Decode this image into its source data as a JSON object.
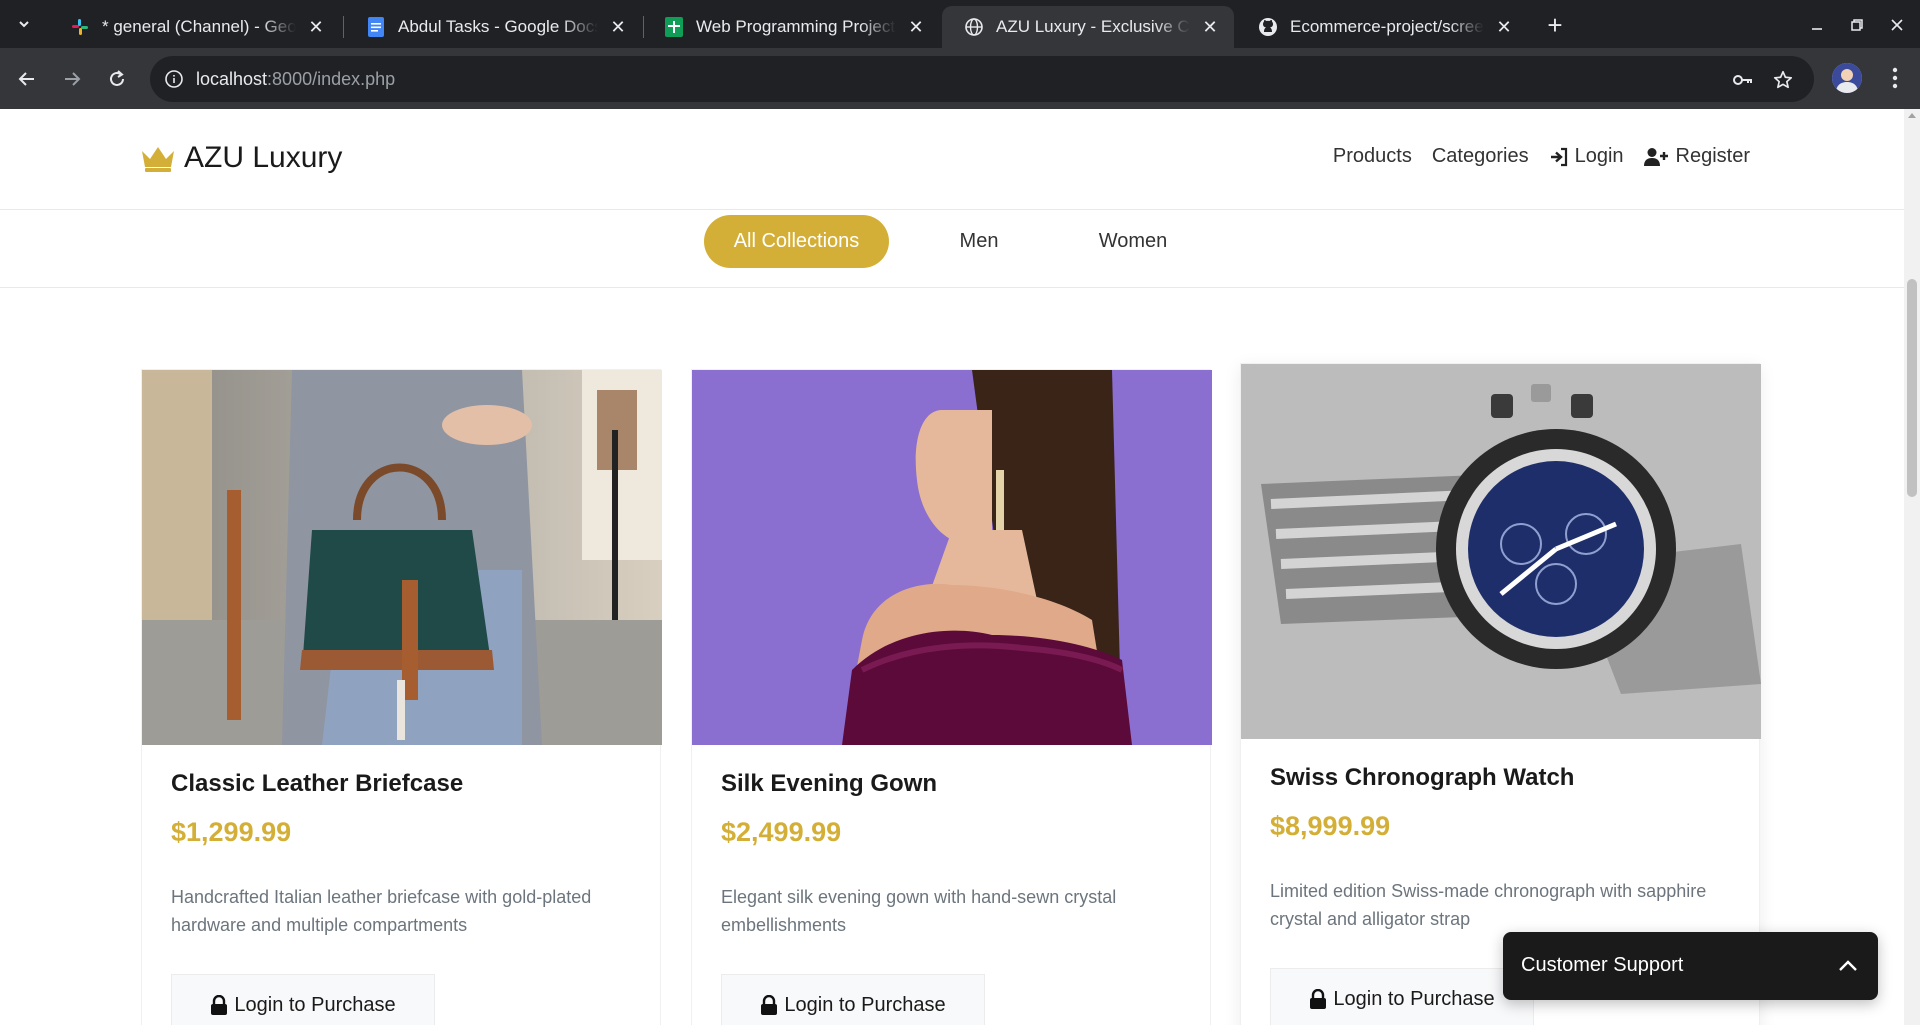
{
  "browser": {
    "tabs": [
      {
        "title": "* general (Channel) - Geonode",
        "icon": "slack-icon",
        "active": false
      },
      {
        "title": "Abdul Tasks - Google Docs",
        "icon": "google-docs-icon",
        "active": false
      },
      {
        "title": "Web Programming Projects",
        "icon": "google-sheets-icon",
        "active": false
      },
      {
        "title": "AZU Luxury - Exclusive Collection",
        "icon": "globe-icon",
        "active": true
      },
      {
        "title": "Ecommerce-project/screenshots",
        "icon": "github-icon",
        "active": false
      }
    ],
    "address": {
      "host": "localhost",
      "rest": ":8000/index.php"
    }
  },
  "site": {
    "brand": "AZU Luxury",
    "nav": {
      "products": "Products",
      "categories": "Categories",
      "login": "Login",
      "register": "Register"
    },
    "filters": [
      "All Collections",
      "Men",
      "Women"
    ],
    "active_filter": "All Collections",
    "colors": {
      "accent": "#d4af37",
      "dark": "#1a1a1a"
    },
    "products": [
      {
        "name": "Classic Leather Briefcase",
        "price": "$1,299.99",
        "description": "Handcrafted Italian leather briefcase with gold-plated hardware and multiple compartments",
        "button": "Login to Purchase"
      },
      {
        "name": "Silk Evening Gown",
        "price": "$2,499.99",
        "description": "Elegant silk evening gown with hand-sewn crystal embellishments",
        "button": "Login to Purchase"
      },
      {
        "name": "Swiss Chronograph Watch",
        "price": "$8,999.99",
        "description": "Limited edition Swiss-made chronograph with sapphire crystal and alligator strap",
        "button": "Login to Purchase"
      }
    ],
    "support": "Customer Support"
  }
}
